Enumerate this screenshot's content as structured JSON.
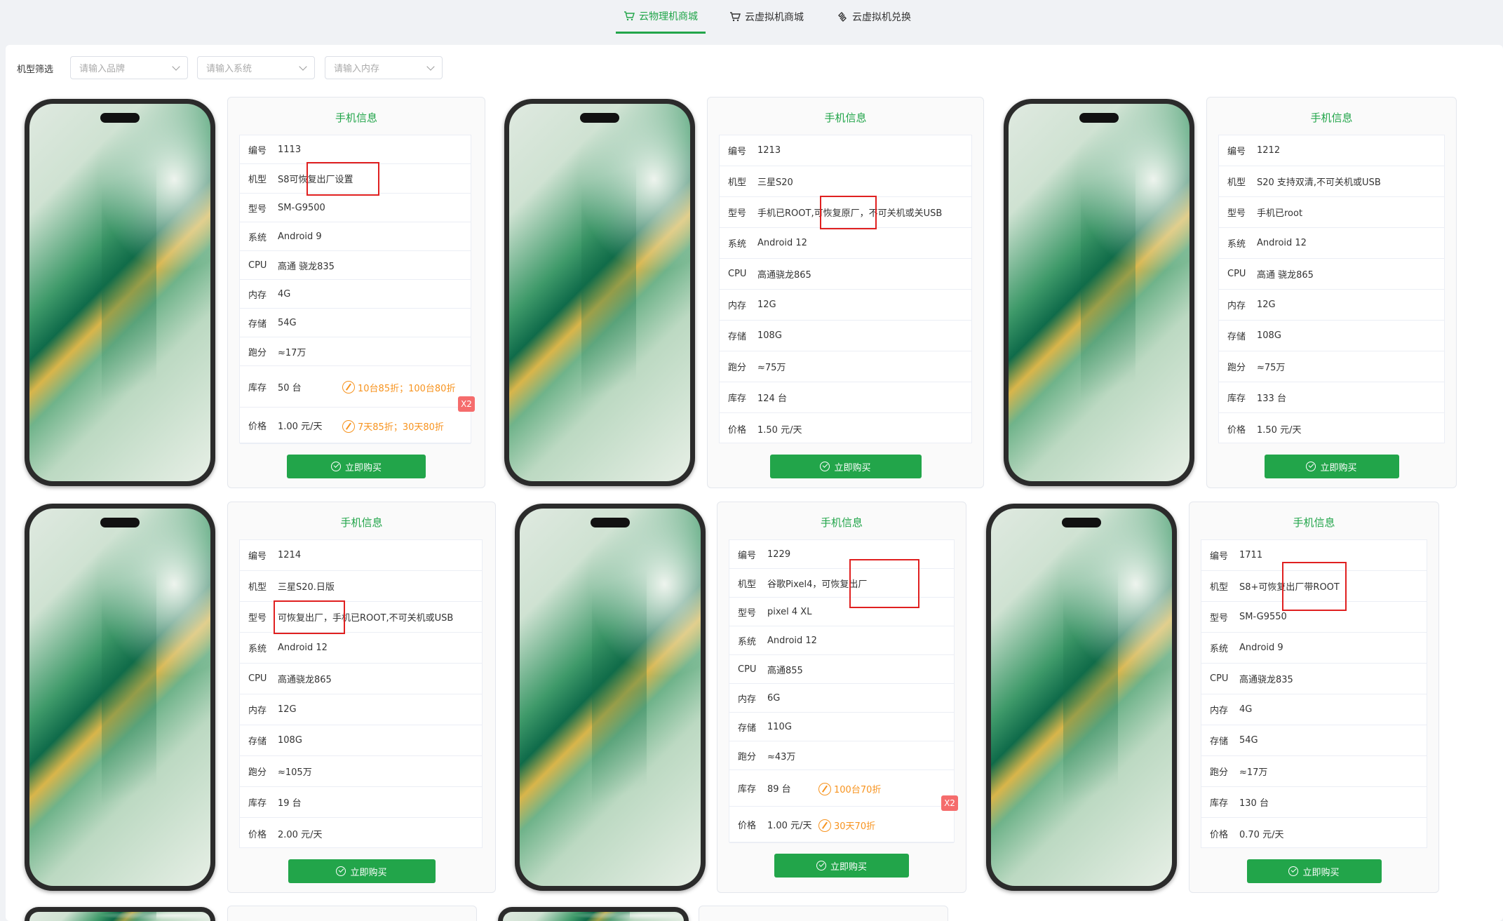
{
  "tabs": [
    {
      "label": "云物理机商城",
      "active": true
    },
    {
      "label": "云虚拟机商城",
      "active": false
    },
    {
      "label": "云虚拟机兑换",
      "active": false
    }
  ],
  "filter": {
    "label": "机型筛选",
    "brand_placeholder": "请输入品牌",
    "system_placeholder": "请输入系统",
    "memory_placeholder": "请输入内存"
  },
  "card_title": "手机信息",
  "buy_label": "立即购买",
  "keys": {
    "id": "编号",
    "model": "机型",
    "type": "型号",
    "system": "系统",
    "cpu": "CPU",
    "memory": "内存",
    "storage": "存储",
    "score": "跑分",
    "stock": "库存",
    "price": "价格"
  },
  "badge": "X2",
  "products": [
    {
      "id": "1113",
      "model": "S8可恢复出厂设置",
      "type": "SM-G9500",
      "system": "Android 9",
      "cpu": "高通 骁龙835",
      "memory": "4G",
      "storage": "54G",
      "score": "≈17万",
      "stock": "50 台",
      "price": "1.00 元/天",
      "stock_discount": "10台85折；100台80折",
      "price_discount": "7天85折；30天80折"
    },
    {
      "id": "1213",
      "model": "三星S20",
      "type": "手机已ROOT,可恢复原厂，不可关机或关USB",
      "system": "Android 12",
      "cpu": "高通骁龙865",
      "memory": "12G",
      "storage": "108G",
      "score": "≈75万",
      "stock": "124 台",
      "price": "1.50 元/天"
    },
    {
      "id": "1212",
      "model": "S20 支持双清,不可关机或USB",
      "type": "手机已root",
      "system": "Android 12",
      "cpu": "高通 骁龙865",
      "memory": "12G",
      "storage": "108G",
      "score": "≈75万",
      "stock": "133 台",
      "price": "1.50 元/天"
    },
    {
      "id": "1214",
      "model": "三星S20.日版",
      "type": "可恢复出厂，手机已ROOT,不可关机或USB",
      "system": "Android 12",
      "cpu": "高通骁龙865",
      "memory": "12G",
      "storage": "108G",
      "score": "≈105万",
      "stock": "19 台",
      "price": "2.00 元/天"
    },
    {
      "id": "1229",
      "model": "谷歌Pixel4，可恢复出厂",
      "type": "pixel 4 XL",
      "system": "Android 12",
      "cpu": "高通855",
      "memory": "6G",
      "storage": "110G",
      "score": "≈43万",
      "stock": "89 台",
      "price": "1.00 元/天",
      "stock_discount": "100台70折",
      "price_discount": "30天70折"
    },
    {
      "id": "1711",
      "model": "S8+可恢复出厂带ROOT",
      "type": "SM-G9550",
      "system": "Android 9",
      "cpu": "高通骁龙835",
      "memory": "4G",
      "storage": "54G",
      "score": "≈17万",
      "stock": "130 台",
      "price": "0.70 元/天"
    }
  ]
}
